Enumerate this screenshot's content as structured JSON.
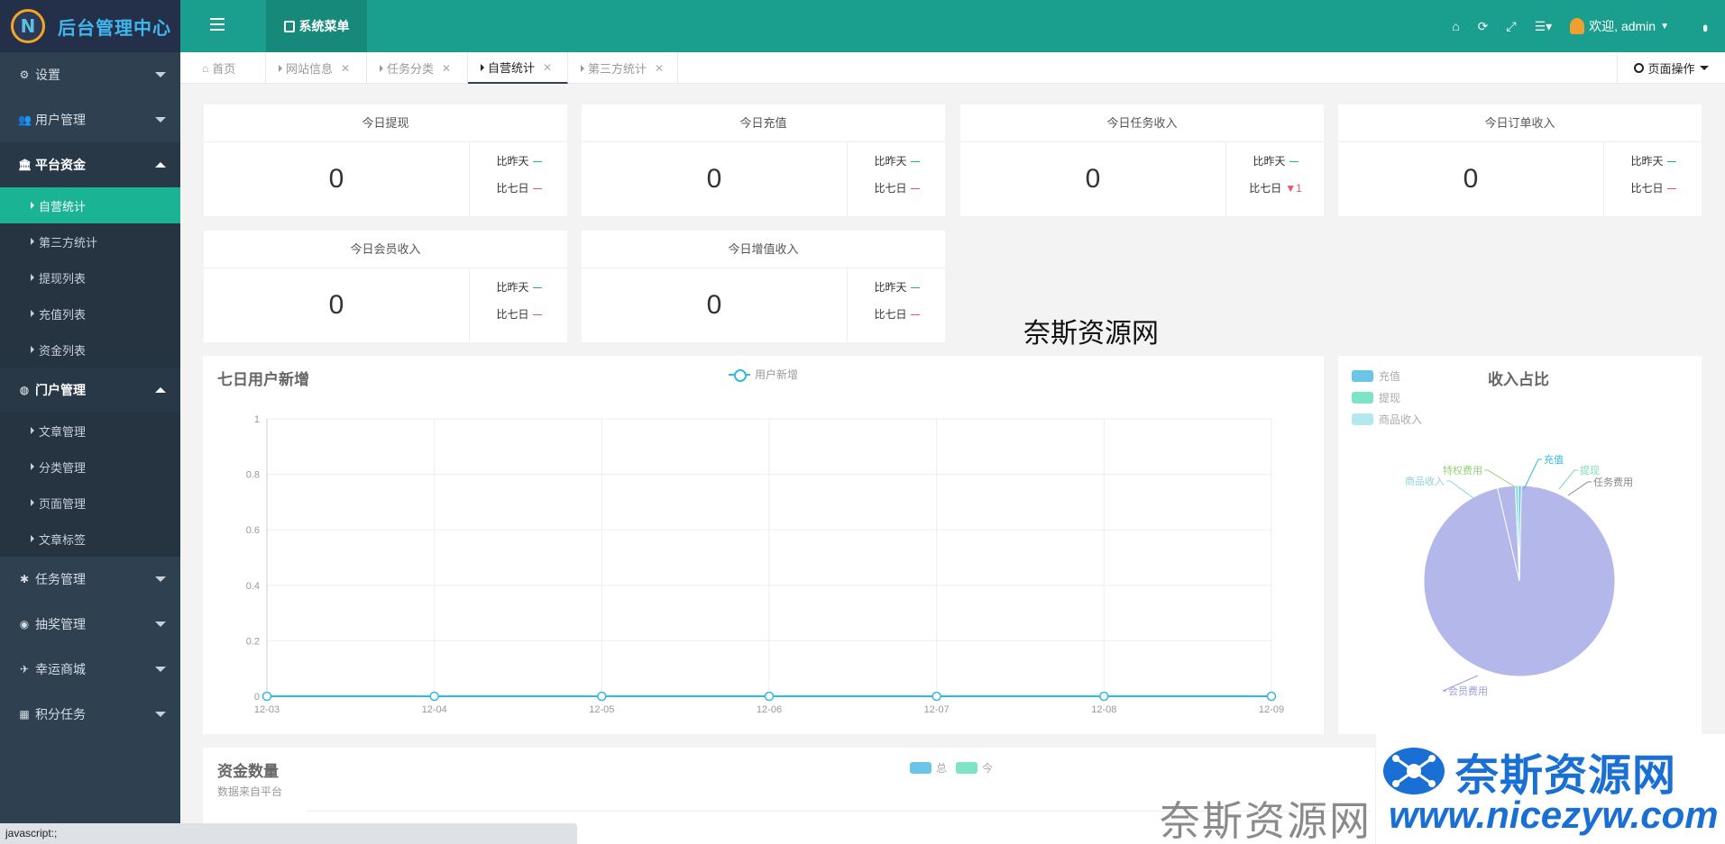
{
  "header": {
    "brand_title": "后台管理中心",
    "sysmenu_label": "系统菜单",
    "welcome": "欢迎, admin"
  },
  "sidebar": {
    "groups": [
      {
        "label": "设置",
        "icon": "gears-icon",
        "open": false
      },
      {
        "label": "用户管理",
        "icon": "users-icon",
        "open": false
      },
      {
        "label": "平台资金",
        "icon": "bank-icon",
        "open": true,
        "items": [
          "自营统计",
          "第三方统计",
          "提现列表",
          "充值列表",
          "资金列表"
        ],
        "active": 0
      },
      {
        "label": "门户管理",
        "icon": "globe-icon",
        "open": true,
        "items": [
          "文章管理",
          "分类管理",
          "页面管理",
          "文章标签"
        ]
      },
      {
        "label": "任务管理",
        "icon": "bug-icon",
        "open": false
      },
      {
        "label": "抽奖管理",
        "icon": "compass-icon",
        "open": false
      },
      {
        "label": "幸运商城",
        "icon": "plane-icon",
        "open": false
      },
      {
        "label": "积分任务",
        "icon": "grid-icon",
        "open": false
      }
    ]
  },
  "tabs": [
    {
      "label": "首页",
      "closable": false
    },
    {
      "label": "网站信息",
      "closable": true
    },
    {
      "label": "任务分类",
      "closable": true
    },
    {
      "label": "自营统计",
      "closable": true,
      "active": true
    },
    {
      "label": "第三方统计",
      "closable": true
    }
  ],
  "page_ops": "页面操作",
  "cards": [
    {
      "title": "今日提现",
      "value": "0",
      "cmp1": "比昨天",
      "cmp2": "比七日",
      "cmp2_change": ""
    },
    {
      "title": "今日充值",
      "value": "0",
      "cmp1": "比昨天",
      "cmp2": "比七日",
      "cmp2_change": ""
    },
    {
      "title": "今日任务收入",
      "value": "0",
      "cmp1": "比昨天",
      "cmp2": "比七日",
      "cmp2_change": "▼1"
    },
    {
      "title": "今日订单收入",
      "value": "0",
      "cmp1": "比昨天",
      "cmp2": "比七日",
      "cmp2_change": ""
    },
    {
      "title": "今日会员收入",
      "value": "0",
      "cmp1": "比昨天",
      "cmp2": "比七日",
      "cmp2_change": ""
    },
    {
      "title": "今日增值收入",
      "value": "0",
      "cmp1": "比昨天",
      "cmp2": "比七日",
      "cmp2_change": ""
    }
  ],
  "watermark_center": "奈斯资源网",
  "watermark_br": {
    "logo": "奈斯资源网",
    "gray": "奈斯资源网",
    "url": "www.nicezyw.com"
  },
  "status_bar": "javascript:;",
  "chart_data": [
    {
      "type": "line",
      "title": "七日用户新增",
      "series": [
        {
          "name": "用户新增",
          "values": [
            0,
            0,
            0,
            0,
            0,
            0,
            0
          ]
        }
      ],
      "x": [
        "12-03",
        "12-04",
        "12-05",
        "12-06",
        "12-07",
        "12-08",
        "12-09"
      ],
      "yticks": [
        "0",
        "0.2",
        "0.4",
        "0.6",
        "0.8",
        "1"
      ],
      "ylim": [
        0,
        1
      ],
      "grid": true,
      "line_color": "#34b7e0"
    },
    {
      "type": "pie",
      "title": "收入占比",
      "legend": [
        {
          "name": "充值",
          "color": "#6bc5e8"
        },
        {
          "name": "提现",
          "color": "#7fe3c6"
        },
        {
          "name": "商品收入",
          "color": "#b5e8ee"
        }
      ],
      "slices": [
        {
          "name": "会员费用",
          "value": 96,
          "color": "#b4b7ea"
        },
        {
          "name": "任务费用",
          "value": 3,
          "color": "#b4b7ea"
        },
        {
          "name": "提现",
          "value": 0.5,
          "color": "#7fe3c6"
        },
        {
          "name": "充值",
          "value": 0.5,
          "color": "#6bc5e8"
        },
        {
          "name": "特权费用",
          "value": 0,
          "color": "#b4e39a"
        },
        {
          "name": "商品收入",
          "value": 0,
          "color": "#b5e8ee"
        }
      ],
      "legend_position": "top-left"
    },
    {
      "type": "bar",
      "title": "资金数量",
      "subtitle": "数据来自平台",
      "series": [
        {
          "name": "总",
          "color": "#6bc5e8"
        },
        {
          "name": "今",
          "color": "#7fe3c6"
        }
      ]
    }
  ]
}
